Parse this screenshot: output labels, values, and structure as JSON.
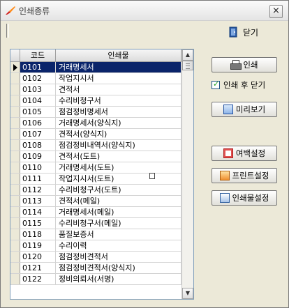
{
  "window": {
    "title": "인쇄종류",
    "close_glyph": "×"
  },
  "toolbar": {
    "close_label": "닫기"
  },
  "grid": {
    "columns": [
      "코드",
      "인쇄물"
    ],
    "rows": [
      {
        "code": "0101",
        "name": "거래명세서",
        "selected": true
      },
      {
        "code": "0102",
        "name": "작업지시서"
      },
      {
        "code": "0103",
        "name": "견적서"
      },
      {
        "code": "0104",
        "name": "수리비청구서"
      },
      {
        "code": "0105",
        "name": "점검정비명세서"
      },
      {
        "code": "0106",
        "name": "거래명세서(양식지)"
      },
      {
        "code": "0107",
        "name": "견적서(양식지)"
      },
      {
        "code": "0108",
        "name": "점검정비내역서(양식지)"
      },
      {
        "code": "0109",
        "name": "견적서(도트)"
      },
      {
        "code": "0110",
        "name": "거래명세서(도트)"
      },
      {
        "code": "0111",
        "name": "작업지시서(도트)"
      },
      {
        "code": "0112",
        "name": "수리비청구서(도트)"
      },
      {
        "code": "0113",
        "name": "견적서(메일)"
      },
      {
        "code": "0114",
        "name": "거래명세서(메일)"
      },
      {
        "code": "0115",
        "name": "수리비청구서(메일)"
      },
      {
        "code": "0118",
        "name": "품질보증서"
      },
      {
        "code": "0119",
        "name": "수리이력"
      },
      {
        "code": "0120",
        "name": "점검정비견적서"
      },
      {
        "code": "0121",
        "name": "점검정비견적서(양식지)"
      },
      {
        "code": "0122",
        "name": "정비의뢰서(서명)"
      }
    ]
  },
  "actions": {
    "print_label": "인쇄",
    "close_after_print_label": "인쇄 후 닫기",
    "close_after_print_checked": true,
    "preview_label": "미리보기",
    "margin_label": "여백설정",
    "printer_label": "프린트설정",
    "item_settings_label": "인쇄물설정"
  },
  "icons": {
    "app": "paint-brush-icon",
    "close_tool": "door-exit-icon",
    "print": "printer-icon",
    "preview": "window-preview-icon",
    "margin": "margin-page-icon",
    "printer_settings": "printer-settings-icon",
    "item_settings": "document-settings-icon"
  },
  "colors": {
    "selection": "#0a246a",
    "window_bg": "#ece9d8",
    "checkmark": "#21a121"
  }
}
